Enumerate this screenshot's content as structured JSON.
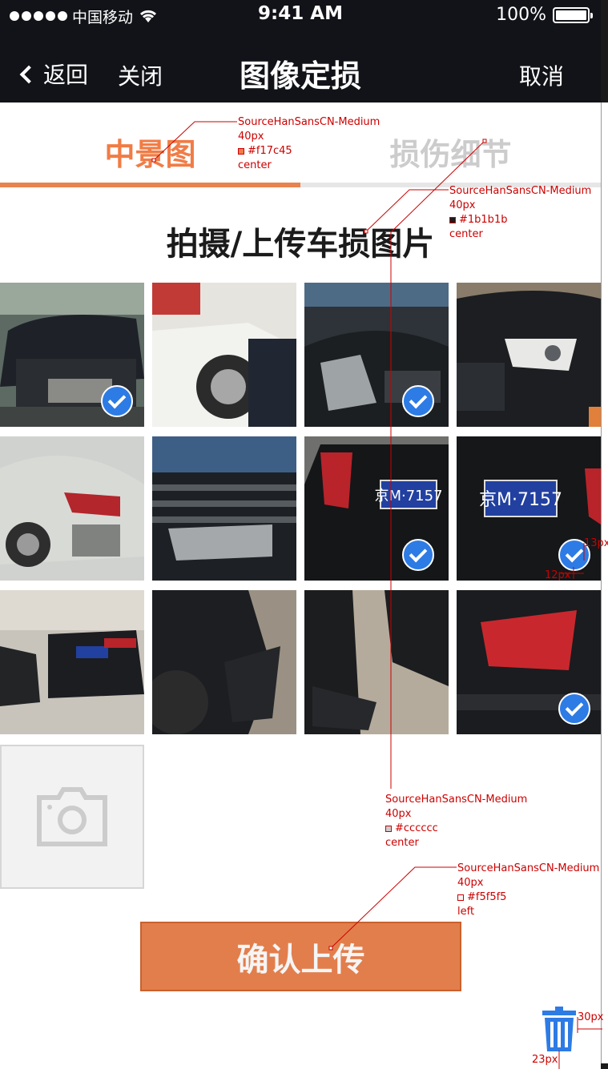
{
  "status_bar": {
    "carrier": "中国移动",
    "time": "9:41 AM",
    "battery": "100%"
  },
  "nav": {
    "back_label": "返回",
    "close_label": "关闭",
    "title": "图像定损",
    "cancel_label": "取消"
  },
  "tabs": [
    {
      "label": "中景图",
      "active": true
    },
    {
      "label": "损伤细节",
      "active": false
    }
  ],
  "section_title": "拍摄/上传车损图片",
  "photos": [
    {
      "name": "car-front-damage",
      "checked": true
    },
    {
      "name": "car-side-wheel",
      "checked": false
    },
    {
      "name": "car-front-grille-damage",
      "checked": true
    },
    {
      "name": "car-headlight",
      "checked": false
    },
    {
      "name": "silver-car-rear-damage",
      "checked": false
    },
    {
      "name": "grille-closeup",
      "checked": false
    },
    {
      "name": "rear-plate-left",
      "checked": true
    },
    {
      "name": "rear-plate-right",
      "checked": true
    },
    {
      "name": "car-rear-street",
      "checked": false
    },
    {
      "name": "rear-bumper-damage",
      "checked": false
    },
    {
      "name": "rear-bumper-damage-2",
      "checked": false
    },
    {
      "name": "rear-taillight",
      "checked": true
    }
  ],
  "confirm_label": "确认上传",
  "annotations": {
    "tab_active": {
      "font": "SourceHanSansCN-Medium",
      "size": "40px",
      "color": "#f17c45",
      "align": "center"
    },
    "section_title": {
      "font": "SourceHanSansCN-Medium",
      "size": "40px",
      "color": "#1b1b1b",
      "align": "center"
    },
    "tab_inactive": {
      "font": "SourceHanSansCN-Medium",
      "size": "40px",
      "color": "#cccccc",
      "align": "center"
    },
    "confirm": {
      "font": "SourceHanSansCN-Medium",
      "size": "40px",
      "color": "#f5f5f5",
      "align": "left"
    },
    "check_right": "13px",
    "check_bottom": "12px",
    "trash_right": "30px",
    "trash_bottom": "23px"
  },
  "colors": {
    "accent": "#f17c45",
    "check_blue": "#2d7be5",
    "trash_blue": "#2d7be5"
  }
}
